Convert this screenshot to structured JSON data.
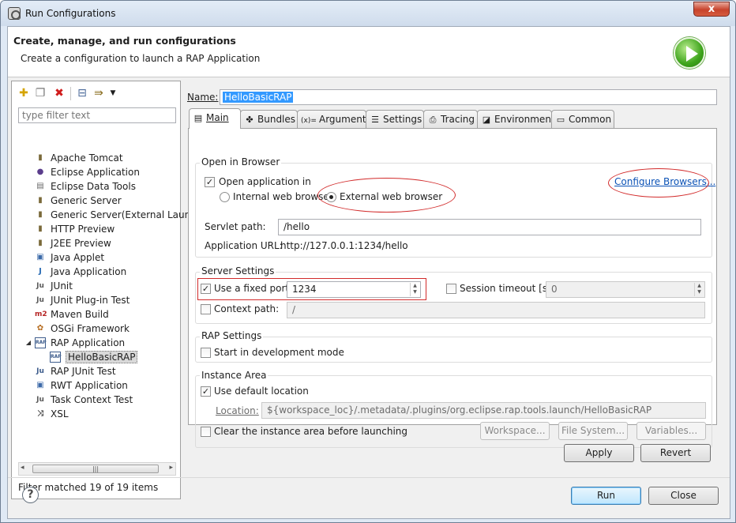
{
  "window": {
    "title": "Run Configurations",
    "close_glyph": "x"
  },
  "header": {
    "title": "Create, manage, and run configurations",
    "subtitle": "Create a configuration to launch a RAP Application"
  },
  "left": {
    "toolbar": [
      "new-config-icon",
      "duplicate-icon",
      "delete-icon",
      "collapse-all-icon",
      "filter-icon",
      "view-menu-icon"
    ],
    "filter_placeholder": "type filter text",
    "tree": [
      {
        "label": "Apache Tomcat",
        "icon": "server-icon",
        "glyph": "▮"
      },
      {
        "label": "Eclipse Application",
        "icon": "eclipse-icon",
        "glyph": "●"
      },
      {
        "label": "Eclipse Data Tools",
        "icon": "database-icon",
        "glyph": "▤"
      },
      {
        "label": "Generic Server",
        "icon": "server-icon",
        "glyph": "▮"
      },
      {
        "label": "Generic Server(External Launcl",
        "icon": "server-icon",
        "glyph": "▮"
      },
      {
        "label": "HTTP Preview",
        "icon": "server-icon",
        "glyph": "▮"
      },
      {
        "label": "J2EE Preview",
        "icon": "server-icon",
        "glyph": "▮"
      },
      {
        "label": "Java Applet",
        "icon": "applet-icon",
        "glyph": "▣"
      },
      {
        "label": "Java Application",
        "icon": "java-app-icon",
        "glyph": "J"
      },
      {
        "label": "JUnit",
        "icon": "junit-icon",
        "glyph": "Ju"
      },
      {
        "label": "JUnit Plug-in Test",
        "icon": "junit-plugin-icon",
        "glyph": "Ju"
      },
      {
        "label": "Maven Build",
        "icon": "maven-icon",
        "glyph": "m2"
      },
      {
        "label": "OSGi Framework",
        "icon": "osgi-icon",
        "glyph": "✿"
      },
      {
        "label": "RAP Application",
        "icon": "rap-icon",
        "glyph": "RAP",
        "expanded": true
      },
      {
        "label": "HelloBasicRAP",
        "icon": "rap-icon",
        "glyph": "RAP",
        "child": true,
        "selected": true
      },
      {
        "label": "RAP JUnit Test",
        "icon": "rap-junit-icon",
        "glyph": "Ju"
      },
      {
        "label": "RWT Application",
        "icon": "rwt-icon",
        "glyph": "▣"
      },
      {
        "label": "Task Context Test",
        "icon": "task-context-icon",
        "glyph": "Ju"
      },
      {
        "label": "XSL",
        "icon": "xsl-icon",
        "glyph": "⤨"
      }
    ],
    "scroll_thumb_glyph": "|||",
    "scroll_left_glyph": "◂",
    "scroll_right_glyph": "▸",
    "filter_status": "Filter matched 19 of 19 items"
  },
  "config": {
    "name_label": "Name:",
    "name_value": "HelloBasicRAP",
    "tabs": [
      {
        "label": "Main",
        "icon": "main-tab-icon",
        "glyph": "▤"
      },
      {
        "label": "Bundles",
        "icon": "bundles-icon",
        "glyph": "✤"
      },
      {
        "label": "Arguments",
        "icon": "arguments-icon",
        "glyph": "(x)="
      },
      {
        "label": "Settings",
        "icon": "settings-icon",
        "glyph": "☰"
      },
      {
        "label": "Tracing",
        "icon": "tracing-icon",
        "glyph": "⎙"
      },
      {
        "label": "Environment",
        "icon": "environment-icon",
        "glyph": "◪"
      },
      {
        "label": "Common",
        "icon": "common-icon",
        "glyph": "▭"
      }
    ],
    "open_in_browser": {
      "title": "Open in Browser",
      "open_app_label": "Open application in",
      "open_app_checked": true,
      "internal_label": "Internal web browser",
      "external_label": "External web browser",
      "selected": "external",
      "configure_link": "Configure Browsers...",
      "servlet_label": "Servlet path:",
      "servlet_value": "/hello",
      "url_label": "Application URL:",
      "url_value": "http://127.0.0.1:1234/hello"
    },
    "server_settings": {
      "title": "Server Settings",
      "fixed_port_label": "Use a fixed port:",
      "fixed_port_checked": true,
      "port_value": "1234",
      "session_timeout_label": "Session timeout [s]:",
      "session_timeout_checked": false,
      "session_timeout_value": "0",
      "context_path_label": "Context path:",
      "context_path_checked": false,
      "context_path_value": "/"
    },
    "rap_settings": {
      "title": "RAP Settings",
      "dev_mode_label": "Start in development mode",
      "dev_mode_checked": false
    },
    "instance_area": {
      "title": "Instance Area",
      "default_location_label": "Use default location",
      "default_location_checked": true,
      "location_label": "Location:",
      "location_value": "${workspace_loc}/.metadata/.plugins/org.eclipse.rap.tools.launch/HelloBasicRAP",
      "clear_label": "Clear the instance area before launching",
      "clear_checked": false,
      "workspace_btn": "Workspace...",
      "filesystem_btn": "File System...",
      "variables_btn": "Variables..."
    },
    "apply_btn": "Apply",
    "revert_btn": "Revert"
  },
  "footer": {
    "help_glyph": "?",
    "run_btn": "Run",
    "close_btn": "Close"
  },
  "colors": {
    "accent": "#3399ff",
    "annotation": "#d22b2b",
    "link": "#0b52b6"
  }
}
